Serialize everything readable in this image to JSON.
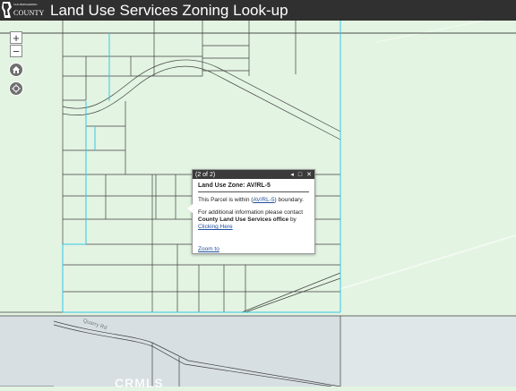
{
  "header": {
    "logo_text": "COUNTY",
    "logo_small": "SAN BERNARDINO",
    "title": "Land Use Services Zoning Look-up"
  },
  "map_controls": {
    "zoom_in": "+",
    "zoom_out": "−"
  },
  "popup": {
    "count": "(2 of 2)",
    "prev": "◂",
    "maximize": "□",
    "close": "✕",
    "title": "Land Use Zone: AV/RL-5",
    "line1_prefix": "This Parcel is within (",
    "line1_link": "AV/RL-5",
    "line1_suffix": ") boundary.",
    "line2_prefix": "For additional information please contact ",
    "line2_bold": "County Land Use Services office",
    "line2_suffix": " by",
    "line2_link": "Clicking Here",
    "zoom_to": "Zoom to"
  },
  "map_labels": {
    "road": "Quarry Rd",
    "watermark": "CRMLS"
  },
  "colors": {
    "header_bg": "#303030",
    "map_bg": "#e3f4e2",
    "parcel_line": "#404040",
    "boundary_line": "#36c9e6",
    "zone_gray": "#d8dfe3"
  }
}
